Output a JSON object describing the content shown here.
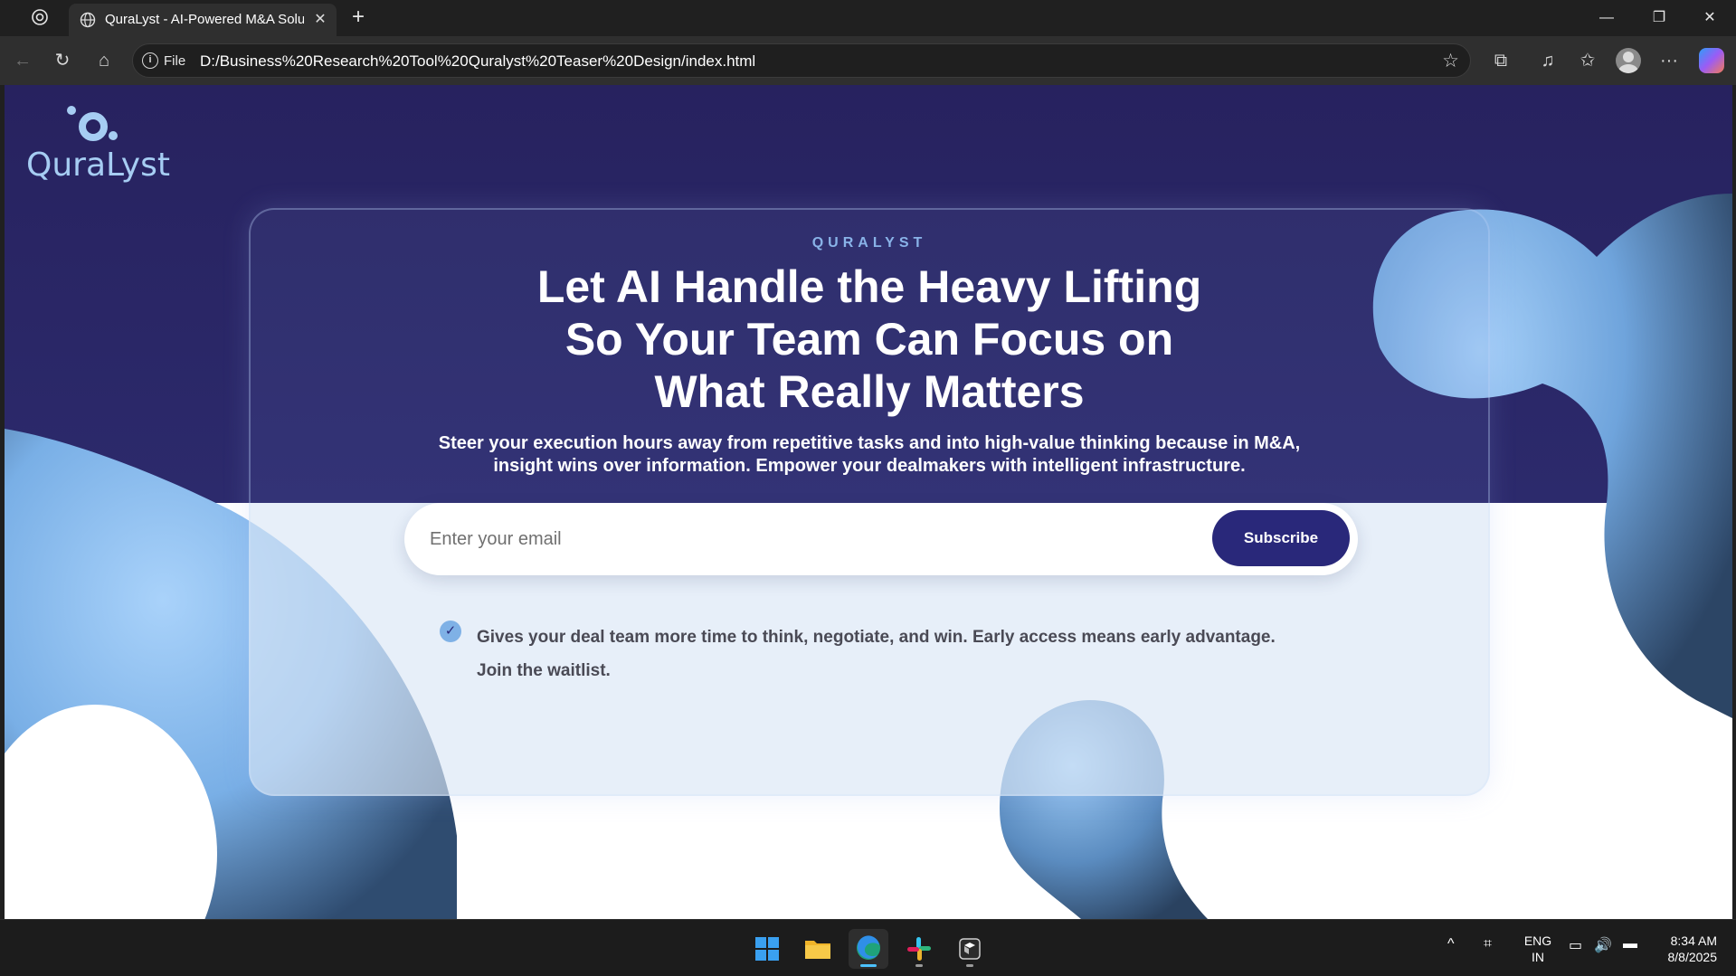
{
  "browser": {
    "tab_title": "QuraLyst - AI-Powered M&A Solu",
    "close_tab": "✕",
    "new_tab": "+",
    "scheme": "File",
    "url": "D:/Business%20Research%20Tool%20Quralyst%20Teaser%20Design/index.html",
    "window_controls": {
      "minimize": "—",
      "restore": "❐",
      "close": "✕"
    },
    "toolbar_glyphs": {
      "back": "←",
      "reload": "↻",
      "home": "⌂",
      "info": "i",
      "star": "☆",
      "extensions": "⧉",
      "favorites_bar": "♫",
      "favorites": "✩",
      "more": "···"
    }
  },
  "page": {
    "logo_text": "QuraLyst",
    "eyebrow": "QURALYST",
    "headline_line1": "Let AI Handle the Heavy Lifting",
    "headline_line2": "So Your Team Can Focus on",
    "headline_line3": "What Really Matters",
    "subtext_line1": "Steer your execution hours away from repetitive tasks and into high-value thinking because in M&A,",
    "subtext_line2": "insight wins over information. Empower your dealmakers with intelligent infrastructure.",
    "email_placeholder": "Enter your email",
    "subscribe_label": "Subscribe",
    "check_glyph": "✓",
    "benefit_line1": "Gives your deal team more time to think, negotiate, and win. Early access means early advantage.",
    "benefit_line2": "Join the waitlist."
  },
  "taskbar": {
    "apps": [
      "start-icon",
      "file-explorer-icon",
      "edge-icon",
      "slack-icon",
      "terminal-icon"
    ],
    "tray_glyphs": {
      "overflow": "^",
      "network": "⌗",
      "wifi": "▭",
      "volume": "🔊",
      "battery": "▬"
    },
    "language_line1": "ENG",
    "language_line2": "IN",
    "time": "8:34 AM",
    "date": "8/8/2025"
  },
  "colors": {
    "hero_navy": "#27225f",
    "accent_blue": "#89b3e8",
    "button": "#29287a",
    "blob_light": "#8ec1f4",
    "blob_dark": "#3a5a80"
  }
}
